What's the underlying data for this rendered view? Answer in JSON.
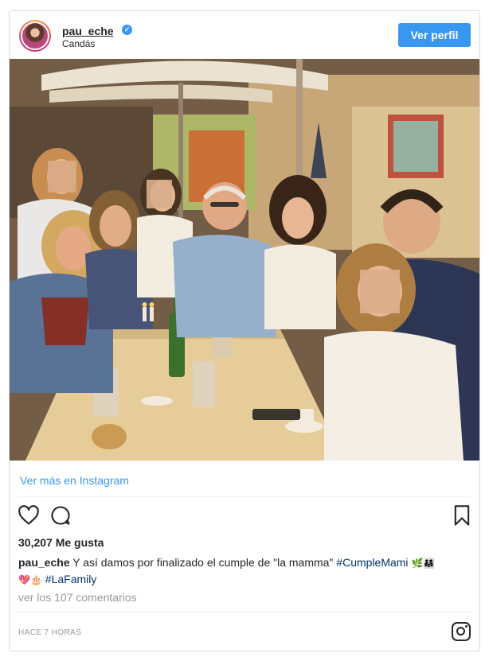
{
  "post": {
    "username": "pau_eche",
    "location": "Candás",
    "follow_label": "Ver perfil",
    "view_more_label": "Ver más en Instagram",
    "likes_text": "30,207 Me gusta",
    "caption_user": "pau_eche",
    "caption_text": " Y así damos por finalizado el cumple de \"la mamma\" ",
    "hashtag_1": "#CumpleMami",
    "emoji_1": "🌿👨‍👩‍👧",
    "emoji_2": "💖🎂",
    "hashtag_2": "#LaFamily",
    "comments_link": "ver los 107 comentarios",
    "timestamp": "HACE 7 HORAS"
  },
  "icons": {
    "avatar": "profile-avatar",
    "verified": "verified-badge-icon",
    "like": "heart-icon",
    "comment": "comment-icon",
    "save": "bookmark-icon",
    "instagram": "instagram-logo-icon"
  },
  "colors": {
    "accent": "#3897f0",
    "text": "#262626",
    "muted": "#999999",
    "hashtag": "#003569",
    "border": "#dbdbdb"
  }
}
